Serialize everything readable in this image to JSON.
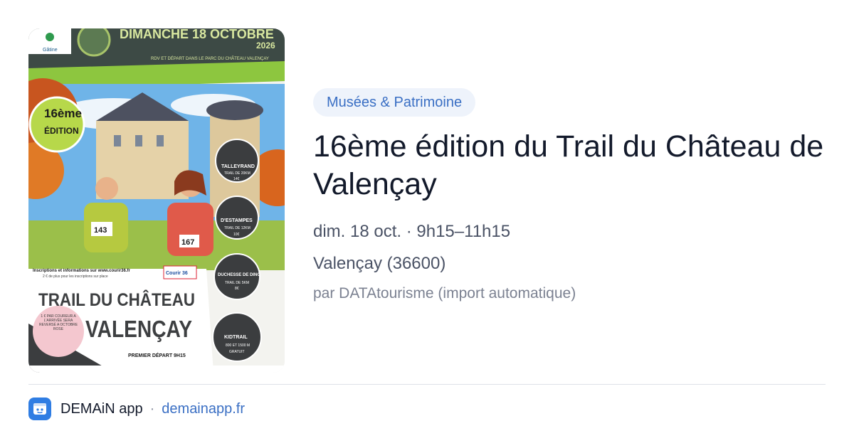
{
  "poster": {
    "date_banner": "DIMANCHE 18 OCTOBRE",
    "year": "2026",
    "rdv_line": "RDV ET DÉPART DANS LE PARC DU CHÂTEAU VALENÇAY",
    "edition_number": "16ème",
    "edition_word": "ÉDITION",
    "courses": [
      {
        "name": "TALLEYRAND",
        "distance": "TRAIL DE 20KM",
        "price": "14€"
      },
      {
        "name": "D'ESTAMPES",
        "distance": "TRAIL DE 12KM",
        "price": "10€"
      },
      {
        "name": "DUCHESSE DE DINO",
        "distance": "TRAIL DE 5KM",
        "price": "8€"
      },
      {
        "name": "KIDTRAIL",
        "distance": "800 ET 1500 M",
        "price": "GRATUIT"
      }
    ],
    "bibs": [
      "143",
      "167"
    ],
    "inscriptions_line": "Inscriptions et informations sur www.courir36.fr",
    "inscriptions_sub": "2 € de plus pour les inscriptions sur place",
    "title_line1": "TRAIL DU CHÂTEAU",
    "title_line2": "VALENÇAY",
    "charity_note": "1 € PAR COUREUR A L'ARRIVÉE SERA REVERSÉ A OCTOBRE ROSE",
    "first_start": "PREMIER DÉPART 9H15",
    "logo_text": "Gâtine",
    "courir_logo": "Courir 36"
  },
  "badge": {
    "label": "Musées & Patrimoine"
  },
  "event": {
    "title": "16ème édition du Trail du Château de Valençay",
    "date_time": "dim. 18 oct. · 9h15–11h15",
    "location": "Valençay (36600)",
    "source": "par DATAtourisme (import automatique)"
  },
  "footer": {
    "app_name": "DEMAiN app",
    "separator": "·",
    "domain": "demainapp.fr",
    "icon": "app-logo-icon"
  },
  "colors": {
    "accent": "#3a6fc4",
    "badge_bg": "#eef3fb",
    "poster_green": "#8dc63f",
    "poster_dark": "#2a2d2e",
    "app_icon": "#2f7de3"
  }
}
